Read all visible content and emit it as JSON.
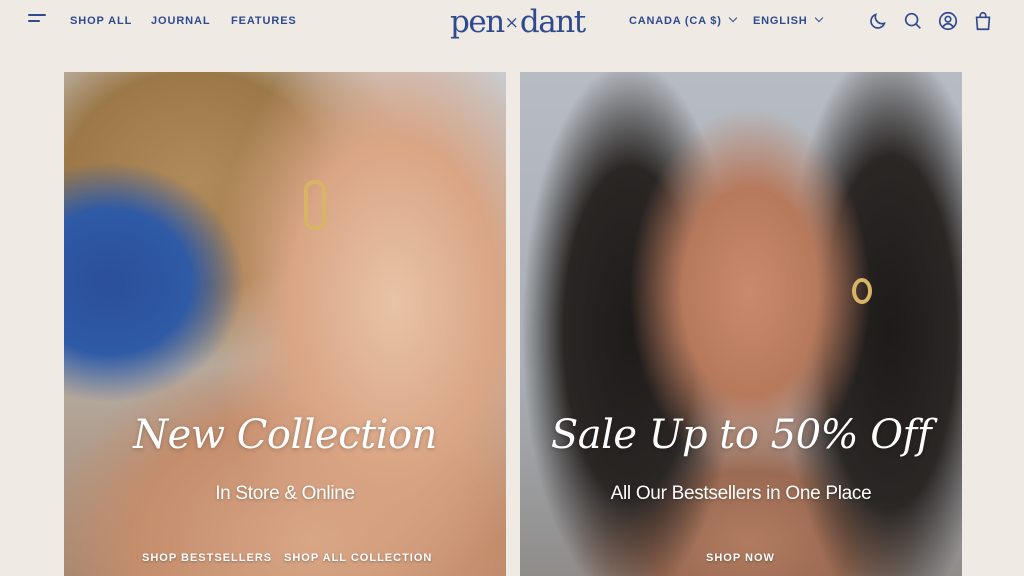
{
  "header": {
    "nav": [
      "SHOP ALL",
      "JOURNAL",
      "FEATURES"
    ],
    "logo_left": "pen",
    "logo_x": "×",
    "logo_right": "dant",
    "currency": "CANADA (CA $)",
    "language": "ENGLISH",
    "icons": [
      "menu-icon",
      "moon-icon",
      "search-icon",
      "account-icon",
      "cart-icon"
    ]
  },
  "panels": [
    {
      "title": "New Collection",
      "subtitle": "In Store & Online",
      "links": [
        "SHOP BESTSELLERS",
        "SHOP ALL COLLECTION"
      ]
    },
    {
      "title": "Sale Up to 50% Off",
      "subtitle": "All Our Bestsellers in One Place",
      "links": [
        "SHOP NOW"
      ]
    }
  ],
  "colors": {
    "brand": "#2f4a8f",
    "background": "#efebe4",
    "overlay_text": "#ffffff"
  }
}
